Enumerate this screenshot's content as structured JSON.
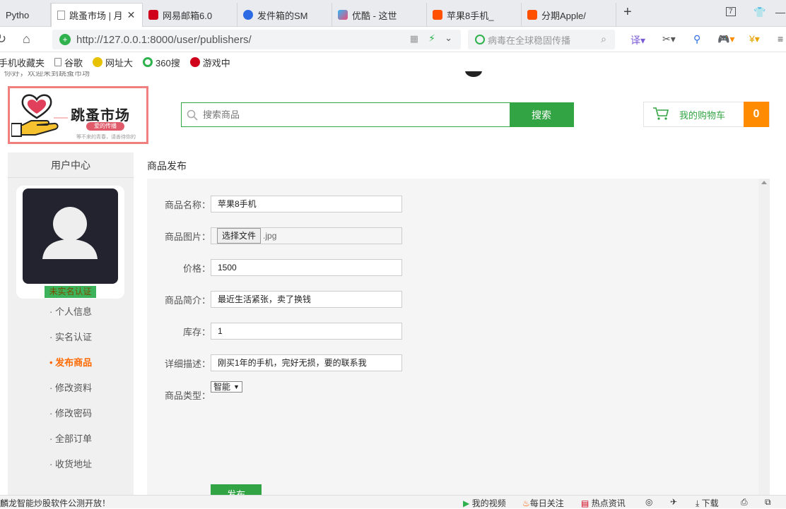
{
  "tabs": [
    {
      "label": "Pytho",
      "active": false
    },
    {
      "label": "跳蚤市场 | 月",
      "active": true
    },
    {
      "label": "网易邮箱6.0",
      "active": false
    },
    {
      "label": "发件箱的SM",
      "active": false
    },
    {
      "label": "优酷 - 这世",
      "active": false
    },
    {
      "label": "苹果8手机_",
      "active": false
    },
    {
      "label": "分期Apple/",
      "active": false
    }
  ],
  "toolbar": {
    "url": "http://127.0.0.1:8000/user/publishers/",
    "search_placeholder": "病毒在全球稳固传播",
    "tab_count": "7"
  },
  "bookmarks": [
    "手机收藏夹",
    "谷歌",
    "网址大",
    "360搜",
    "游戏中"
  ],
  "header": {
    "top_left": "你好，欢迎来到跳蚤市场",
    "logo_title": "跳蚤市场",
    "logo_badge": "爱的传播",
    "logo_slogan": "等不来的青春，请善待你的",
    "search_placeholder": "搜索商品",
    "search_button": "搜索",
    "cart_label": "我的购物车",
    "cart_count": "0"
  },
  "sidebar": {
    "title": "用户中心",
    "verify_badge": "未实名认证",
    "menu": [
      {
        "label": "· 个人信息",
        "active": false
      },
      {
        "label": "· 实名认证",
        "active": false
      },
      {
        "label": "• 发布商品",
        "active": true
      },
      {
        "label": "· 修改资料",
        "active": false
      },
      {
        "label": "· 修改密码",
        "active": false
      },
      {
        "label": "· 全部订单",
        "active": false
      },
      {
        "label": "· 收货地址",
        "active": false
      }
    ]
  },
  "form": {
    "breadcrumb": "商品发布",
    "name_label": "商品名称：",
    "name_value": "苹果8手机",
    "image_label": "商品图片：",
    "file_button": "选择文件",
    "file_name": ".jpg",
    "price_label": "价格：",
    "price_value": "1500",
    "intro_label": "商品简介：",
    "intro_value": "最近生活紧张，卖了换钱",
    "stock_label": "库存：",
    "stock_value": "1",
    "desc_label": "详细描述：",
    "desc_value": "刚买1年的手机，完好无损，要的联系我",
    "type_label": "商品类型：",
    "type_value": "智能",
    "submit_label": "发布"
  },
  "statusbar": {
    "news": "麟龙智能炒股软件公测开放！",
    "items": [
      "我的视频",
      "每日关注",
      "热点资讯",
      "下载"
    ]
  },
  "colors": {
    "brand_green": "#33a444",
    "cart_orange": "#ff8c00",
    "active_menu": "#ff6a00",
    "logo_border": "#f08080"
  }
}
